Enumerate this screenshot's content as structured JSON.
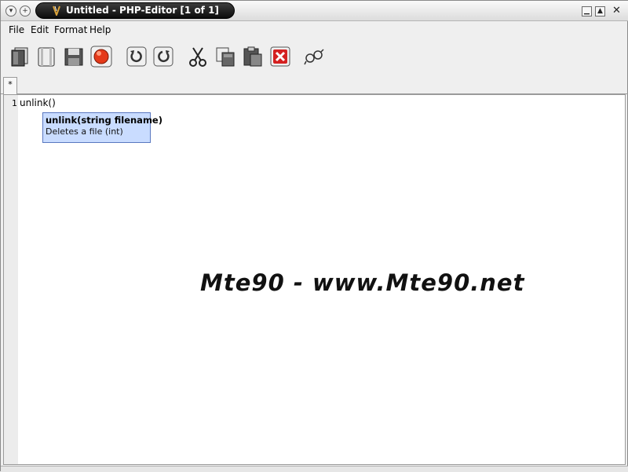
{
  "window": {
    "title": "Untitled - PHP-Editor [1 of 1]",
    "left_buttons": [
      "menu-down-icon",
      "sticky-plus-icon"
    ],
    "right_buttons": [
      "minimize-icon",
      "maximize-icon",
      "close-icon"
    ]
  },
  "menu": {
    "items": [
      {
        "label": "File"
      },
      {
        "label": "Edit"
      },
      {
        "label": "Format"
      },
      {
        "label": "Help"
      }
    ]
  },
  "toolbar": {
    "icons": [
      "new-file-icon",
      "open-file-icon",
      "save-icon",
      "record-icon",
      "undo-icon",
      "redo-icon",
      "cut-icon",
      "copy-icon",
      "paste-icon",
      "delete-icon",
      "find-icon"
    ]
  },
  "tabs": [
    {
      "label": "*"
    }
  ],
  "editor": {
    "line_number": "1",
    "code": "unlink()",
    "tooltip": {
      "signature": "unlink(string filename)",
      "description": "Deletes a file (int)"
    }
  },
  "watermark": {
    "text": "Mte90 - www.Mte90.net"
  },
  "colors": {
    "title_pill": "#0b0b0b",
    "tooltip_bg": "#c9dcff",
    "tooltip_border": "#5a78c0",
    "record_red": "#e53a1a",
    "delete_red": "#d42020"
  }
}
